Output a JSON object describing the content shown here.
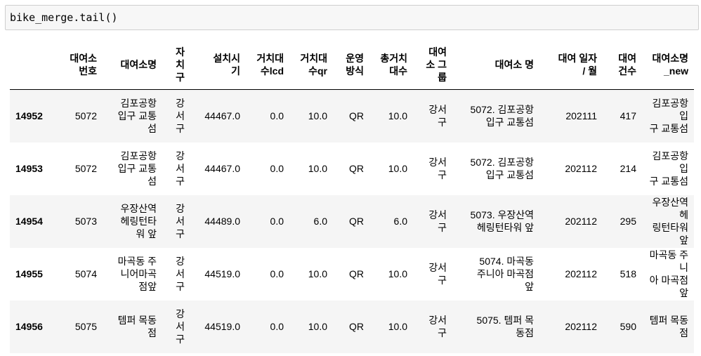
{
  "code_cell": {
    "source": "bike_merge.tail()"
  },
  "dataframe": {
    "columns": [
      "대여소\n번호",
      "대여소명",
      "자\n치\n구",
      "설치시\n기",
      "거치대\n수lcd",
      "거치대\n수qr",
      "운영\n방식",
      "총거치\n대수",
      "대여\n소 그\n룹",
      "대여소 명",
      "대여 일자\n/ 월",
      "대여\n건수",
      "대여소명\n_new"
    ],
    "rows": [
      {
        "index": "14952",
        "cells": [
          "5072",
          "김포공항\n입구 교통\n섬",
          "강\n서\n구",
          "44467.0",
          "0.0",
          "10.0",
          "QR",
          "10.0",
          "강서\n구",
          "5072. 김포공항\n입구 교통섬",
          "202111",
          "417",
          "김포공항입\n구 교통섬"
        ]
      },
      {
        "index": "14953",
        "cells": [
          "5072",
          "김포공항\n입구 교통\n섬",
          "강\n서\n구",
          "44467.0",
          "0.0",
          "10.0",
          "QR",
          "10.0",
          "강서\n구",
          "5072. 김포공항\n입구 교통섬",
          "202112",
          "214",
          "김포공항입\n구 교통섬"
        ]
      },
      {
        "index": "14954",
        "cells": [
          "5073",
          "우장산역\n헤링턴타\n워 앞",
          "강\n서\n구",
          "44489.0",
          "0.0",
          "6.0",
          "QR",
          "6.0",
          "강서\n구",
          "5073. 우장산역\n헤링턴타워 앞",
          "202112",
          "295",
          "우장산역 헤\n링턴타워 앞"
        ]
      },
      {
        "index": "14955",
        "cells": [
          "5074",
          "마곡동 주\n니어마곡\n점앞",
          "강\n서\n구",
          "44519.0",
          "0.0",
          "10.0",
          "QR",
          "10.0",
          "강서\n구",
          "5074. 마곡동\n주니아 마곡점\n앞",
          "202112",
          "518",
          "마곡동 주니\n아 마곡점 앞"
        ]
      },
      {
        "index": "14956",
        "cells": [
          "5075",
          "템퍼 목동\n점",
          "강\n서\n구",
          "44519.0",
          "0.0",
          "10.0",
          "QR",
          "10.0",
          "강서\n구",
          "5075. 템퍼 목\n동점",
          "202112",
          "590",
          "템퍼 목동점"
        ]
      }
    ]
  }
}
